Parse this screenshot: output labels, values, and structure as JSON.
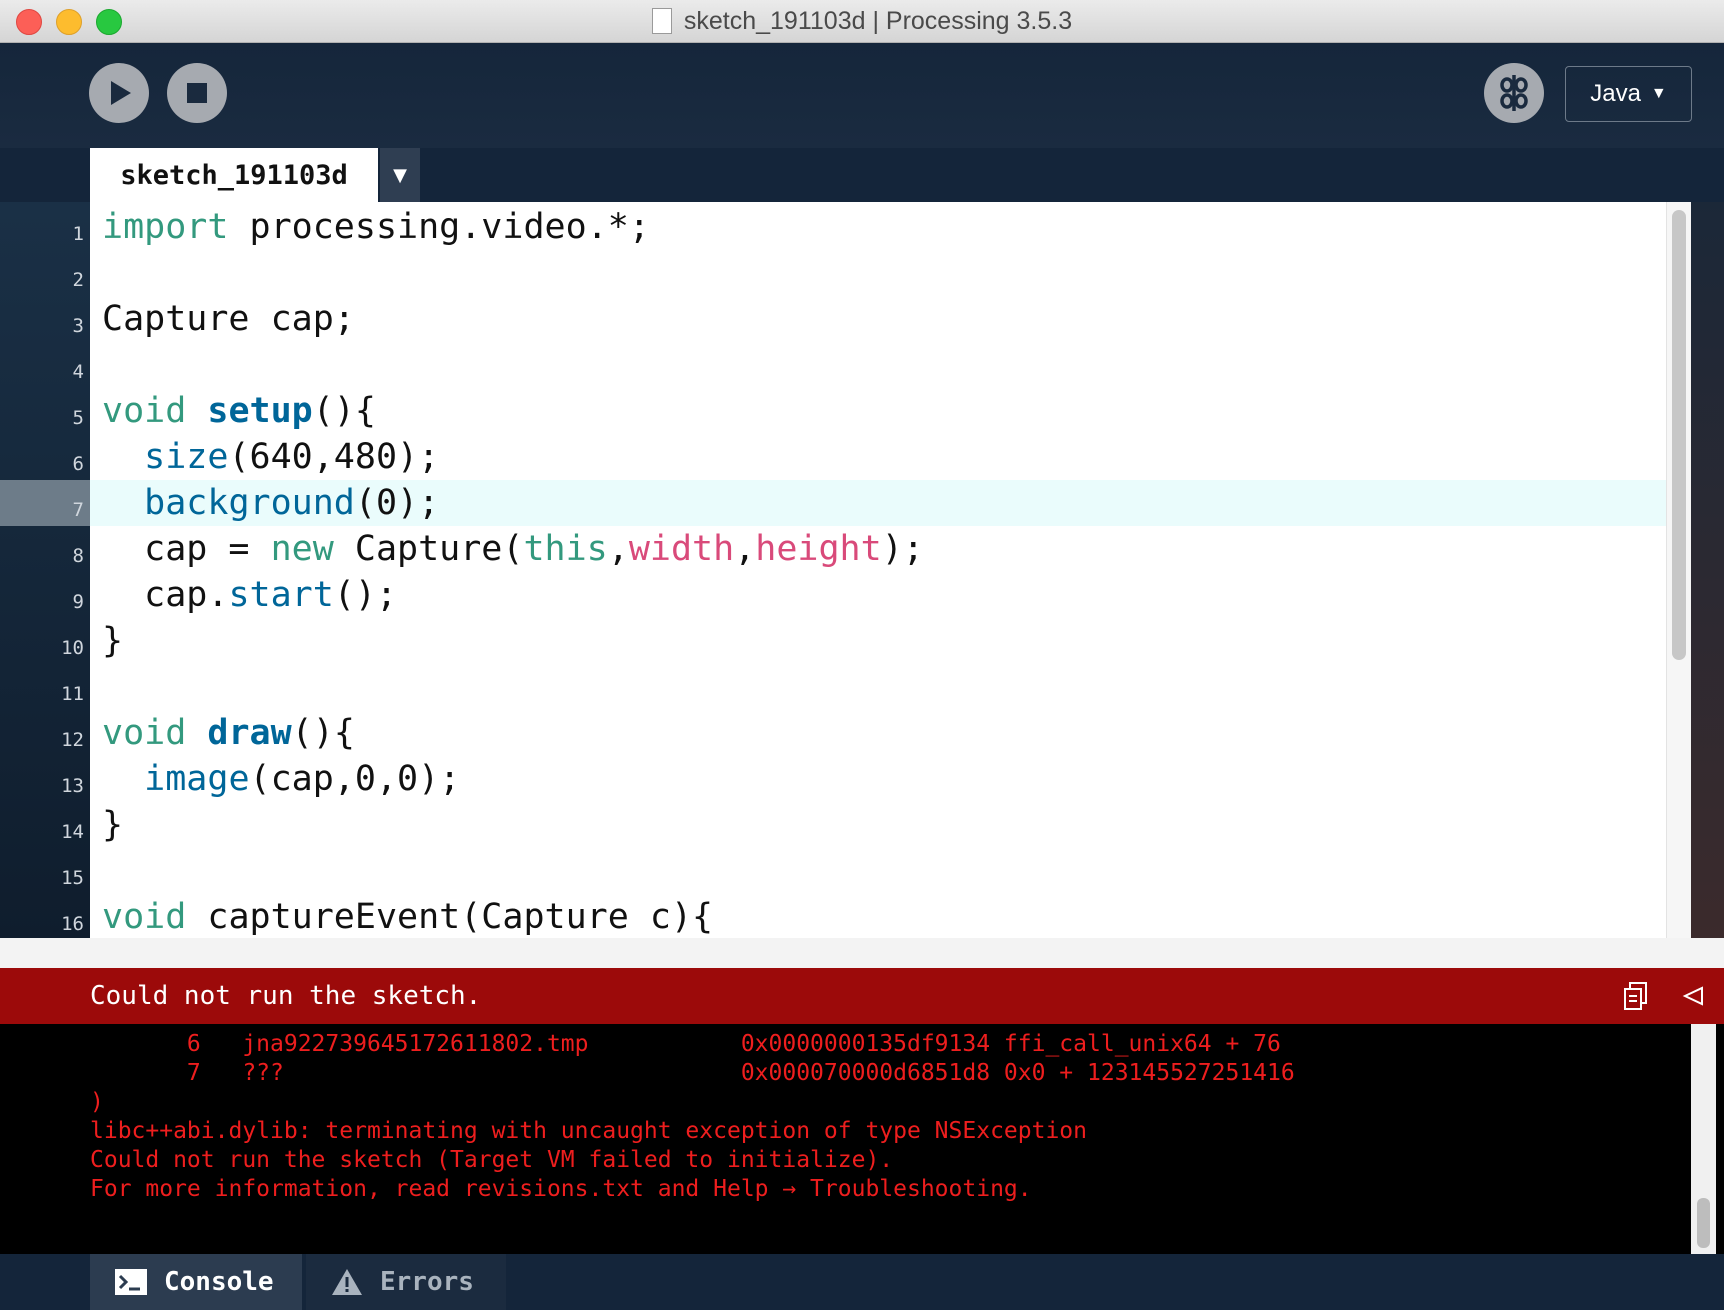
{
  "window": {
    "title": "sketch_191103d | Processing 3.5.3"
  },
  "toolbar": {
    "run_icon": "play-icon",
    "stop_icon": "stop-icon",
    "debug_icon": "debugger-icon",
    "mode": "Java",
    "mode_caret": "▼"
  },
  "tabs": {
    "active": "sketch_191103d",
    "menu_caret": "▼"
  },
  "editor": {
    "current_line": 7,
    "lines": [
      {
        "n": "1",
        "tokens": [
          {
            "t": "import",
            "c": "kw"
          },
          {
            "t": " processing.video.*;",
            "c": ""
          }
        ]
      },
      {
        "n": "2",
        "tokens": []
      },
      {
        "n": "3",
        "tokens": [
          {
            "t": "Capture cap;",
            "c": ""
          }
        ]
      },
      {
        "n": "4",
        "tokens": []
      },
      {
        "n": "5",
        "tokens": [
          {
            "t": "void",
            "c": "kw"
          },
          {
            "t": " ",
            "c": ""
          },
          {
            "t": "setup",
            "c": "fn"
          },
          {
            "t": "(){",
            "c": ""
          }
        ]
      },
      {
        "n": "6",
        "tokens": [
          {
            "t": "  ",
            "c": ""
          },
          {
            "t": "size",
            "c": "call"
          },
          {
            "t": "(640,480);",
            "c": ""
          }
        ]
      },
      {
        "n": "7",
        "tokens": [
          {
            "t": "  ",
            "c": ""
          },
          {
            "t": "background",
            "c": "call"
          },
          {
            "t": "(0);",
            "c": ""
          }
        ]
      },
      {
        "n": "8",
        "tokens": [
          {
            "t": "  cap = ",
            "c": ""
          },
          {
            "t": "new",
            "c": "kw"
          },
          {
            "t": " Capture(",
            "c": ""
          },
          {
            "t": "this",
            "c": "kw"
          },
          {
            "t": ",",
            "c": ""
          },
          {
            "t": "width",
            "c": "var"
          },
          {
            "t": ",",
            "c": ""
          },
          {
            "t": "height",
            "c": "var"
          },
          {
            "t": ");",
            "c": ""
          }
        ]
      },
      {
        "n": "9",
        "tokens": [
          {
            "t": "  cap.",
            "c": ""
          },
          {
            "t": "start",
            "c": "call"
          },
          {
            "t": "();",
            "c": ""
          }
        ]
      },
      {
        "n": "10",
        "tokens": [
          {
            "t": "}",
            "c": ""
          }
        ]
      },
      {
        "n": "11",
        "tokens": []
      },
      {
        "n": "12",
        "tokens": [
          {
            "t": "void",
            "c": "kw"
          },
          {
            "t": " ",
            "c": ""
          },
          {
            "t": "draw",
            "c": "fn"
          },
          {
            "t": "(){",
            "c": ""
          }
        ]
      },
      {
        "n": "13",
        "tokens": [
          {
            "t": "  ",
            "c": ""
          },
          {
            "t": "image",
            "c": "call"
          },
          {
            "t": "(cap,0,0);",
            "c": ""
          }
        ]
      },
      {
        "n": "14",
        "tokens": [
          {
            "t": "}",
            "c": ""
          }
        ]
      },
      {
        "n": "15",
        "tokens": []
      },
      {
        "n": "16",
        "tokens": [
          {
            "t": "void",
            "c": "kw"
          },
          {
            "t": " captureEvent(Capture c){",
            "c": ""
          }
        ]
      }
    ]
  },
  "error_bar": {
    "message": "Could not run the sketch.",
    "copy_icon": "copy-icon",
    "collapse_icon": "collapse-left-icon"
  },
  "console": {
    "lines": [
      "       6   jna922739645172611802.tmp           0x0000000135df9134 ffi_call_unix64 + 76",
      "       7   ???                                 0x000070000d6851d8 0x0 + 123145527251416",
      ")",
      "libc++abi.dylib: terminating with uncaught exception of type NSException",
      "Could not run the sketch (Target VM failed to initialize).",
      "For more information, read revisions.txt and Help → Troubleshooting."
    ]
  },
  "footer": {
    "console_tab": "Console",
    "errors_tab": "Errors",
    "console_icon": "terminal-icon",
    "errors_icon": "warning-icon"
  },
  "colors": {
    "keyword": "#33997e",
    "function": "#006699",
    "variable": "#d94a7a",
    "error_bar": "#9c0a0a",
    "console_text": "#ee1e1e"
  }
}
